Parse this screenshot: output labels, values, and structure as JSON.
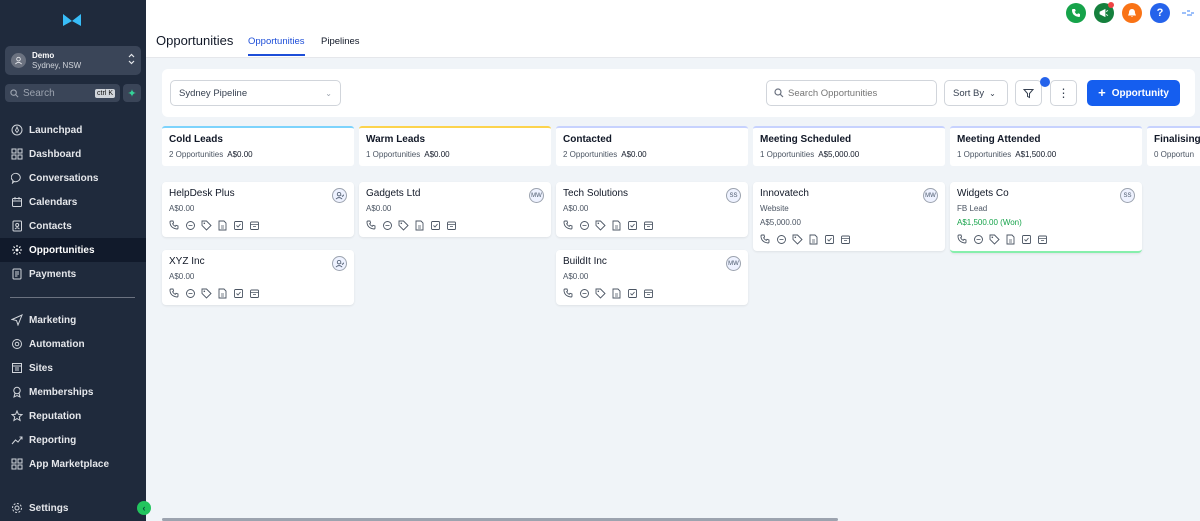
{
  "account": {
    "name": "Demo",
    "location": "Sydney, NSW"
  },
  "sidebar": {
    "search_placeholder": "Search",
    "search_shortcut": "ctrl K",
    "items": [
      {
        "label": "Launchpad",
        "icon": "rocket-icon"
      },
      {
        "label": "Dashboard",
        "icon": "grid-icon"
      },
      {
        "label": "Conversations",
        "icon": "chat-icon"
      },
      {
        "label": "Calendars",
        "icon": "calendar-icon"
      },
      {
        "label": "Contacts",
        "icon": "contacts-icon"
      },
      {
        "label": "Opportunities",
        "icon": "opportunities-icon",
        "active": true
      },
      {
        "label": "Payments",
        "icon": "payments-icon"
      },
      {
        "label": "Marketing",
        "icon": "send-icon"
      },
      {
        "label": "Automation",
        "icon": "automation-icon"
      },
      {
        "label": "Sites",
        "icon": "sites-icon"
      },
      {
        "label": "Memberships",
        "icon": "membership-icon"
      },
      {
        "label": "Reputation",
        "icon": "star-icon"
      },
      {
        "label": "Reporting",
        "icon": "chart-icon"
      },
      {
        "label": "App Marketplace",
        "icon": "apps-icon"
      },
      {
        "label": "Settings",
        "icon": "gear-icon"
      }
    ]
  },
  "header": {
    "title": "Opportunities",
    "tabs": [
      {
        "label": "Opportunities",
        "active": true
      },
      {
        "label": "Pipelines",
        "active": false
      }
    ],
    "help_label": "?"
  },
  "toolbar": {
    "pipeline": "Sydney Pipeline",
    "search_placeholder": "Search Opportunities",
    "sort_label": "Sort By",
    "add_label": "Opportunity"
  },
  "colors": {
    "accent": "#155eef",
    "phone": "#16a34a",
    "announce": "#15803d",
    "bell": "#f97316",
    "help": "#2563eb",
    "won": "#16a34a"
  },
  "columns": [
    {
      "title": "Cold Leads",
      "count": "2 Opportunities",
      "amount": "A$0.00",
      "color": "#7dd3fc",
      "cards": [
        {
          "title": "HelpDesk Plus",
          "lines": [
            "A$0.00"
          ],
          "owner": ""
        },
        {
          "title": "XYZ Inc",
          "lines": [
            "A$0.00"
          ],
          "owner": ""
        }
      ]
    },
    {
      "title": "Warm Leads",
      "count": "1 Opportunities",
      "amount": "A$0.00",
      "color": "#fcd34d",
      "cards": [
        {
          "title": "Gadgets Ltd",
          "lines": [
            "A$0.00"
          ],
          "owner": "MW"
        }
      ]
    },
    {
      "title": "Contacted",
      "count": "2 Opportunities",
      "amount": "A$0.00",
      "color": "#c7d2fe",
      "cards": [
        {
          "title": "Tech Solutions",
          "lines": [
            "A$0.00"
          ],
          "owner": "SS"
        },
        {
          "title": "BuildIt Inc",
          "lines": [
            "A$0.00"
          ],
          "owner": "MW"
        }
      ]
    },
    {
      "title": "Meeting Scheduled",
      "count": "1 Opportunities",
      "amount": "A$5,000.00",
      "color": "#c7d2fe",
      "cards": [
        {
          "title": "Innovatech",
          "lines": [
            "Website",
            "A$5,000.00"
          ],
          "owner": "MW"
        }
      ]
    },
    {
      "title": "Meeting Attended",
      "count": "1 Opportunities",
      "amount": "A$1,500.00",
      "color": "#c7d2fe",
      "cards": [
        {
          "title": "Widgets Co",
          "lines": [
            "FB Lead",
            "A$1,500.00 (Won)"
          ],
          "owner": "SS",
          "won": true
        }
      ]
    },
    {
      "title": "Finalising",
      "count": "0 Opportun",
      "amount": "",
      "color": "#c7d2fe",
      "cards": []
    }
  ]
}
